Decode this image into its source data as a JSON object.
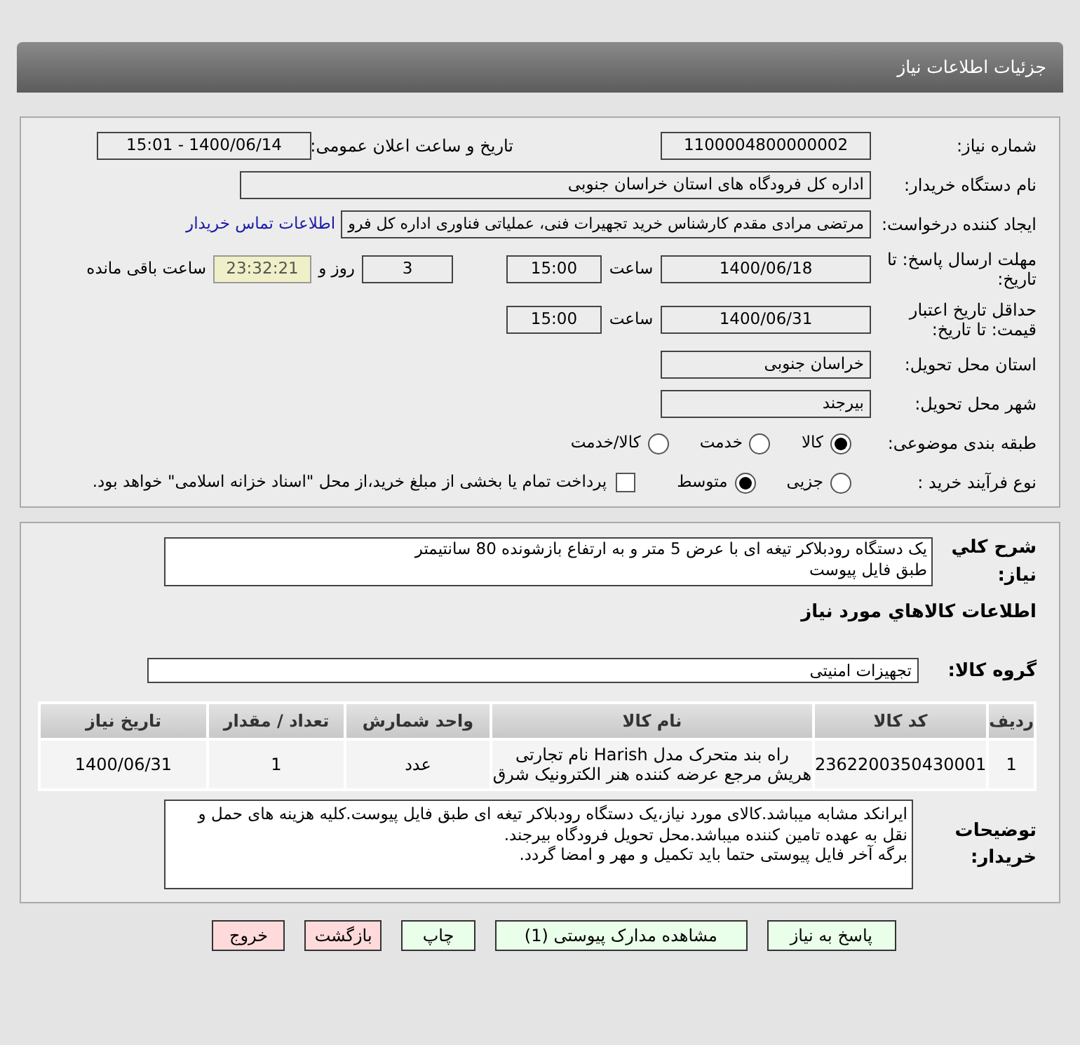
{
  "header": {
    "title": "جزئیات اطلاعات نیاز"
  },
  "need_number": {
    "label": "شماره نیاز:",
    "value": "1100004800000002"
  },
  "announce": {
    "label": "تاریخ و ساعت اعلان عمومی:",
    "value": "1400/06/14 - 15:01"
  },
  "buyer_org": {
    "label": "نام دستگاه خریدار:",
    "value": "اداره کل فرودگاه های استان خراسان جنوبی"
  },
  "requester": {
    "label": "ایجاد کننده درخواست:",
    "value": "مرتضی مرادی مقدم کارشناس خرید تجهیرات فنی، عملیاتی فناوری اداره کل فرو",
    "link": "اطلاعات تماس خریدار"
  },
  "deadline": {
    "label": "مهلت ارسال پاسخ: تا تاریخ:",
    "date": "1400/06/18",
    "time_label": "ساعت",
    "time": "15:00",
    "days": "3",
    "days_label": "روز و",
    "remaining": "23:32:21",
    "remaining_label": "ساعت باقی مانده"
  },
  "validity": {
    "label": "حداقل تاریخ اعتبار قیمت: تا تاریخ:",
    "date": "1400/06/31",
    "time_label": "ساعت",
    "time": "15:00"
  },
  "province": {
    "label": "استان محل تحویل:",
    "value": "خراسان جنوبی"
  },
  "city": {
    "label": "شهر محل تحویل:",
    "value": "بیرجند"
  },
  "category": {
    "label": "طبقه بندی موضوعی:",
    "options": [
      {
        "label": "کالا",
        "selected": true
      },
      {
        "label": "خدمت",
        "selected": false
      },
      {
        "label": "کالا/خدمت",
        "selected": false
      }
    ]
  },
  "process": {
    "label": "نوع فرآیند خرید :",
    "options": [
      {
        "label": "جزیی",
        "selected": false
      },
      {
        "label": "متوسط",
        "selected": true
      }
    ],
    "payment": {
      "checked": false,
      "text": "پرداخت تمام یا بخشی از مبلغ خرید،از محل \"اسناد خزانه اسلامی\" خواهد بود."
    }
  },
  "summary": {
    "label": "شرح کلي نياز:",
    "lines": [
      "یک دستگاه رودبلاکر تیغه ای با عرض 5 متر و به ارتفاع بازشونده 80 سانتیمتر",
      "طبق فایل پیوست"
    ]
  },
  "goods_title": "اطلاعات کالاهاي مورد نياز",
  "goods_group": {
    "label": "گروه کالا:",
    "value": "تجهیزات امنیتی"
  },
  "table": {
    "columns": [
      "ردیف",
      "کد کالا",
      "نام کالا",
      "واحد شمارش",
      "تعداد / مقدار",
      "تاریخ نیاز"
    ],
    "rows": [
      [
        "1",
        "2362200350430001",
        "راه بند متحرک مدل Harish نام تجارتی هریش مرجع عرضه کننده هنر الکترونیک شرق",
        "عدد",
        "1",
        "1400/06/31"
      ]
    ]
  },
  "notes": {
    "label": "توضیحات خریدار:",
    "lines": [
      "ایرانکد مشابه میباشد.کالای مورد نیاز،یک دستگاه رودبلاکر تیغه ای طبق فایل پیوست.کلیه هزینه های حمل و نقل به عهده تامین کننده میباشد.محل تحویل فرودگاه بیرجند.",
      "برگه آخر فایل پیوستی حتما باید تکمیل و مهر و امضا گردد."
    ]
  },
  "buttons": [
    {
      "label": "پاسخ به نیاز",
      "kind": "action"
    },
    {
      "label": "مشاهده مدارک پیوستی (1)",
      "kind": "action"
    },
    {
      "label": "چاپ",
      "kind": "action"
    },
    {
      "label": "بازگشت",
      "kind": "exit"
    },
    {
      "label": "خروج",
      "kind": "exit"
    }
  ]
}
